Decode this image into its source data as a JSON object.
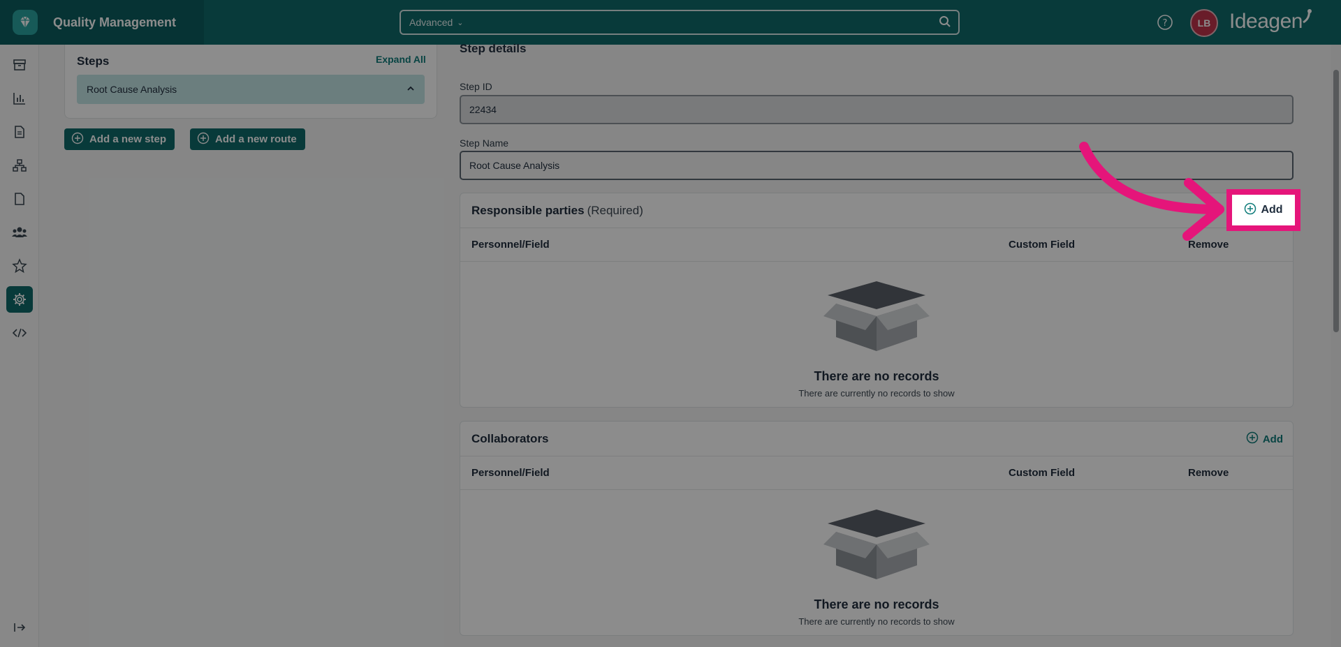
{
  "app": {
    "title": "Quality Management",
    "brand": "Ideagen",
    "user_initials": "LB"
  },
  "search": {
    "mode": "Advanced"
  },
  "colors": {
    "primary": "#0f6a6a",
    "highlight": "#e5157a",
    "avatar": "#c0334b"
  },
  "sidebar": {
    "icons": [
      "archive-icon",
      "bar-chart-icon",
      "document-icon",
      "sitemap-icon",
      "file-icon",
      "team-icon",
      "star-icon",
      "gear-icon",
      "code-icon"
    ],
    "active": "gear-icon",
    "collapse_icon": "collapse-arrow-icon"
  },
  "steps": {
    "title": "Steps",
    "expand_label": "Expand All",
    "items": [
      {
        "label": "Root Cause Analysis"
      }
    ],
    "add_step_label": "Add a new step",
    "add_route_label": "Add a new route"
  },
  "details": {
    "title": "Step details",
    "step_id_label": "Step ID",
    "step_id_value": "22434",
    "step_name_label": "Step Name",
    "step_name_value": "Root Cause Analysis"
  },
  "responsible": {
    "title": "Responsible parties",
    "required": "(Required)",
    "add_label": "Add",
    "columns": [
      "Personnel/Field",
      "Custom Field",
      "Remove"
    ],
    "empty_title": "There are no records",
    "empty_sub": "There are currently no records to show"
  },
  "collaborators": {
    "title": "Collaborators",
    "add_label": "Add",
    "columns": [
      "Personnel/Field",
      "Custom Field",
      "Remove"
    ],
    "empty_title": "There are no records",
    "empty_sub": "There are currently no records to show"
  }
}
